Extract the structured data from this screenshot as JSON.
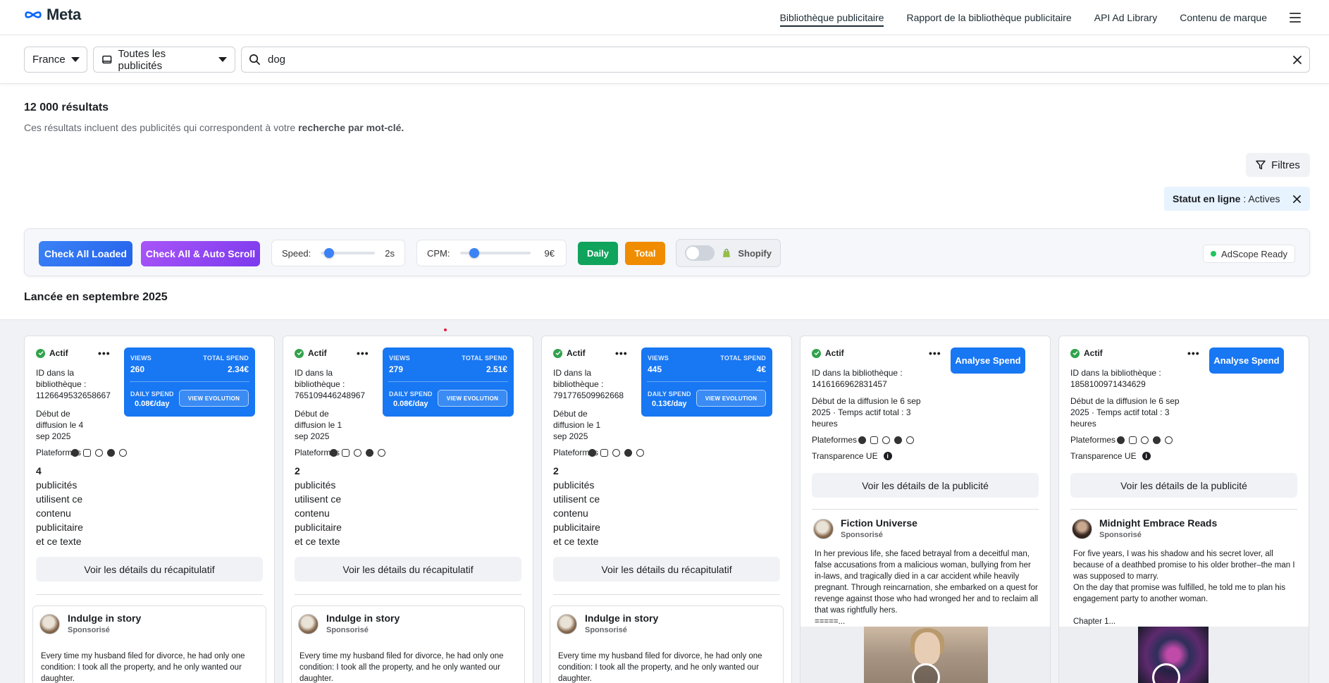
{
  "header": {
    "logo_text": "Meta",
    "nav": [
      {
        "label": "Bibliothèque publicitaire",
        "active": true
      },
      {
        "label": "Rapport de la bibliothèque publicitaire"
      },
      {
        "label": "API Ad Library"
      },
      {
        "label": "Contenu de marque"
      }
    ]
  },
  "filters": {
    "country": "France",
    "ad_type": "Toutes les publicités",
    "search_value": "dog"
  },
  "results": {
    "count_label": "12 000 résultats",
    "subtitle_prefix": "Ces résultats incluent des publicités qui correspondent à votre ",
    "subtitle_bold": "recherche par mot-clé."
  },
  "filters_button": "Filtres",
  "status_chip": {
    "label": "Statut en ligne",
    "value": " : Actives"
  },
  "toolbar": {
    "check_all_loaded": "Check All Loaded",
    "check_all_auto_scroll": "Check All & Auto Scroll",
    "speed_label": "Speed:",
    "speed_value": "2s",
    "speed_level": 0.15,
    "cpm_label": "CPM:",
    "cpm_value": "9€",
    "cpm_level": 0.2,
    "daily": "Daily",
    "total": "Total",
    "shopify": "Shopify",
    "ready": "AdScope Ready",
    "colors": {
      "blue": "#2563eb",
      "purple": "#7c3aed",
      "daily": "#10a35c",
      "total": "#f08c00"
    }
  },
  "section_title": "Lancée en septembre 2025",
  "common": {
    "active": "Actif",
    "platforms_label": "Plateformes",
    "eu_transparency": "Transparence UE",
    "sponsored": "Sponsorisé",
    "views_label": "VIEWS",
    "total_spend_label": "TOTAL SPEND",
    "daily_spend_label": "DAILY SPEND",
    "view_evolution": "VIEW EVOLUTION",
    "analyse_spend": "Analyse Spend",
    "details_summary": "Voir les détails du récapitulatif",
    "details_ad": "Voir les détails de la publicité",
    "usage_rest": "publicités\nutilisent ce\ncontenu\npublicitaire\net ce texte"
  },
  "cards": [
    {
      "id_text": "ID dans la bibliothèque : 1126649532658667",
      "start_text": "Début de diffusion le 4 sep 2025",
      "views": "260",
      "total_spend": "2.34€",
      "daily_spend": "0.08€/day",
      "usage_count": "4",
      "page_name": "Indulge in story",
      "ad_text": "Every time my husband filed for divorce, he had only one condition: I took all the property, and he only wanted our daughter."
    },
    {
      "id_text": "ID dans la bibliothèque : 765109446248967",
      "start_text": "Début de diffusion le 1 sep 2025",
      "views": "279",
      "total_spend": "2.51€",
      "daily_spend": "0.08€/day",
      "usage_count": "2",
      "page_name": "Indulge in story",
      "ad_text": "Every time my husband filed for divorce, he had only one condition: I took all the property, and he only wanted our daughter."
    },
    {
      "id_text": "ID dans la bibliothèque : 791776509962668",
      "start_text": "Début de diffusion le 1 sep 2025",
      "views": "445",
      "total_spend": "4€",
      "daily_spend": "0.13€/day",
      "usage_count": "2",
      "page_name": "Indulge in story",
      "ad_text": "Every time my husband filed for divorce, he had only one condition: I took all the property, and he only wanted our daughter."
    },
    {
      "id_text": "ID dans la bibliothèque : 1416166962831457",
      "start_text": "Début de la diffusion le 6 sep 2025 · Temps actif total : 3 heures",
      "page_name": "Fiction Universe",
      "ad_text": "In her previous life, she faced betrayal from a deceitful man, false accusations from a malicious woman, bullying from her in-laws, and tragically died in a car accident while heavily pregnant. Through reincarnation, she embarked on a quest for revenge against those who had wronged her and to reclaim all that was rightfully hers.\n=====..."
    },
    {
      "id_text": "ID dans la bibliothèque : 1858100971434629",
      "start_text": "Début de la diffusion le 6 sep 2025 · Temps actif total : 3 heures",
      "page_name": "Midnight Embrace Reads",
      "ad_text": "For five years, I was his shadow and his secret lover, all because of a deathbed promise to his older brother–the man I was supposed to marry.\nOn the day that promise was fulfilled, he told me to plan his engagement party to another woman.\n\nChapter 1..."
    }
  ]
}
